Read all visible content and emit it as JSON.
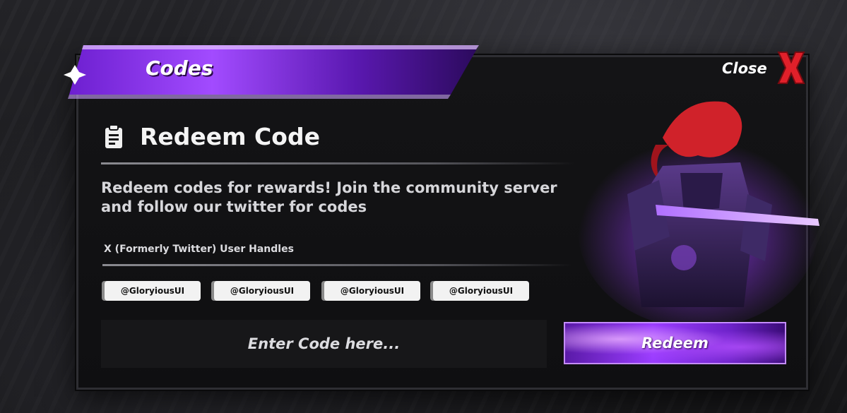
{
  "header": {
    "title": "Codes",
    "close_label": "Close"
  },
  "content": {
    "heading": "Redeem Code",
    "description": "Redeem codes for rewards! Join the community server and follow our twitter for codes",
    "handles_label": "X (Formerly Twitter) User Handles",
    "handles": [
      "@GloryiousUI",
      "@GloryiousUI",
      "@GloryiousUI",
      "@GloryiousUI"
    ]
  },
  "code_input": {
    "placeholder": "Enter Code here..."
  },
  "redeem_button": {
    "label": "Redeem"
  },
  "colors": {
    "accent_purple": "#9b3dff",
    "close_red": "#e0202a",
    "panel_bg": "#121214"
  },
  "icons": {
    "heading_icon": "clipboard-icon",
    "close_icon": "close-x-icon"
  }
}
